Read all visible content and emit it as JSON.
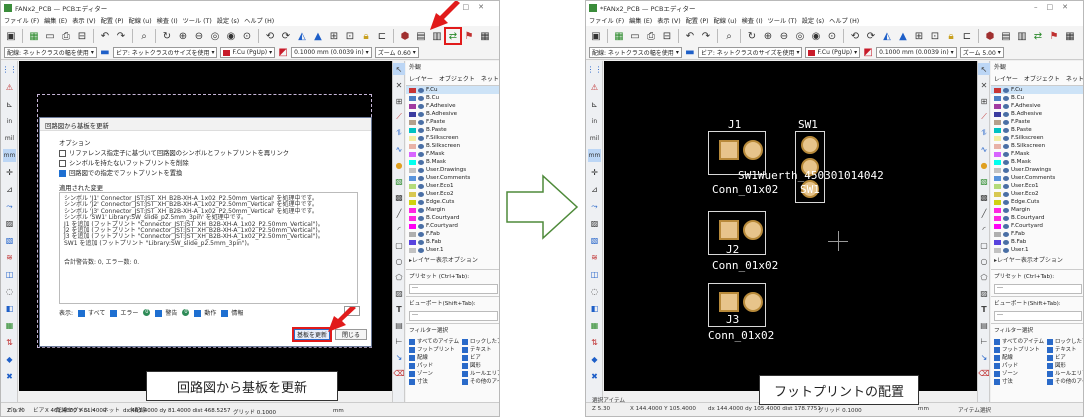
{
  "editor_left": {
    "title": "FANx2_PCB — PCBエディター",
    "menu": [
      "ファイル (F)",
      "編集 (E)",
      "表示 (V)",
      "配置 (P)",
      "配線 (u)",
      "検査 (I)",
      "ツール (T)",
      "設定 (s)",
      "ヘルプ (H)"
    ],
    "toolbar2": {
      "track_select": "配線: ネットクラスの幅を使用",
      "via_select": "ビア: ネットクラスのサイズを使用",
      "layer": "F.Cu (PgUp)",
      "grid": "0.1000 mm (0.0039 in)",
      "zoom": "ズーム 0.60"
    },
    "left_labels": {
      "in": "in",
      "mil": "mil",
      "mm": "mm"
    },
    "status": {
      "pad": "パッド",
      "via": "ビア",
      "track_segments": "配線セグメント",
      "net": "ネット",
      "unrouted": "未配線",
      "z": "Z 0.70",
      "coords": "X 461.4000  Y 81.4000",
      "delta": "dx 461.4000  dy 81.4000  dist 468.5257",
      "grid": "グリッド 0.1000",
      "unit": "mm"
    }
  },
  "dialog": {
    "title": "回路図から基板を更新",
    "options_heading": "オプション",
    "options": [
      {
        "label": "リファレンス指定子に基づいて回路図のシンボルとフットプリントを再リンク",
        "checked": false
      },
      {
        "label": "シンボルを持たないフットプリントを削除",
        "checked": false
      },
      {
        "label": "回路図での指定でフットプリントを置換",
        "checked": true
      }
    ],
    "changes_heading": "適用された変更",
    "changes": [
      "シンボル 'J1' Connector_JST:JST_XH_B2B-XH-A_1x02_P2.50mm_Vertical' を処理中です。",
      "シンボル 'J2' Connector_JST:JST_XH_B2B-XH-A_1x02_P2.50mm_Vertical' を処理中です。",
      "シンボル 'J3' Connector_JST:JST_XH_B2B-XH-A_1x02_P2.50mm_Vertical' を処理中です。",
      "シンボル 'SW1' Library:SW_slide_p2.5mm_3pin' を処理中です。",
      "J1 を追加 (フットプリント \"Connector_JST:JST_XH_B2B-XH-A_1x02_P2.50mm_Vertical\")。",
      "J2 を追加 (フットプリント \"Connector_JST:JST_XH_B2B-XH-A_1x02_P2.50mm_Vertical\")。",
      "J3 を追加 (フットプリント \"Connector_JST:JST_XH_B2B-XH-A_1x02_P2.50mm_Vertical\")。",
      "SW1 を追加 (フットプリント \"Library:SW_slide_p2.5mm_3pin\")。",
      "",
      "",
      "合計警告数: 0, エラー数: 0."
    ],
    "filter": {
      "show": "表示:",
      "all": "すべて",
      "errors": "エラー",
      "errors_count": "0",
      "warnings": "警告",
      "warnings_count": "0",
      "actions": "動作",
      "info": "情報"
    },
    "update_button": "基板を更新",
    "close_button": "閉じる"
  },
  "editor_right": {
    "title": "*FANx2_PCB — PCBエディター",
    "menu": [
      "ファイル (F)",
      "編集 (E)",
      "表示 (V)",
      "配置 (P)",
      "配線 (u)",
      "検査 (I)",
      "ツール (T)",
      "設定 (s)",
      "ヘルプ (H)"
    ],
    "toolbar2": {
      "track_select": "配線: ネットクラスの幅を使用",
      "via_select": "ビア: ネットクラスのサイズを使用",
      "layer": "F.Cu (PgUp)",
      "grid": "0.1000 mm (0.0039 in)",
      "zoom": "ズーム 5.00"
    },
    "appearance": {
      "heading": "外観",
      "tabs": [
        "レイヤー",
        "オブジェクト",
        "ネット"
      ],
      "layers": [
        {
          "name": "F.Cu",
          "color": "#c83434"
        },
        {
          "name": "B.Cu",
          "color": "#4d7fc4"
        },
        {
          "name": "F.Adhesive",
          "color": "#a13ba1"
        },
        {
          "name": "B.Adhesive",
          "color": "#3c3ca0"
        },
        {
          "name": "F.Paste",
          "color": "#b4a08c"
        },
        {
          "name": "B.Paste",
          "color": "#00c2c2"
        },
        {
          "name": "F.Silkscreen",
          "color": "#f2eda1"
        },
        {
          "name": "B.Silkscreen",
          "color": "#e8b2a7"
        },
        {
          "name": "F.Mask",
          "color": "#d864ff"
        },
        {
          "name": "B.Mask",
          "color": "#02ffee"
        },
        {
          "name": "User.Drawings",
          "color": "#c2c2c2"
        },
        {
          "name": "User.Comments",
          "color": "#5994dc"
        },
        {
          "name": "User.Eco1",
          "color": "#b4db79"
        },
        {
          "name": "User.Eco2",
          "color": "#d8c852"
        },
        {
          "name": "Edge.Cuts",
          "color": "#d0d210"
        },
        {
          "name": "Margin",
          "color": "#ff26e2"
        },
        {
          "name": "B.Courtyard",
          "color": "#ff26e2"
        },
        {
          "name": "F.Courtyard",
          "color": "#ff00f5"
        },
        {
          "name": "F.Fab",
          "color": "#afafaf"
        },
        {
          "name": "B.Fab",
          "color": "#5843dd"
        },
        {
          "name": "User.1",
          "color": "#c2c2c2"
        }
      ],
      "layer_options": "▸レイヤー表示オプション",
      "presets_label": "プリセット (Ctrl+Tab):",
      "presets_value": "---",
      "viewports_label": "ビューポート(Shift+Tab):",
      "viewports_value": "---"
    },
    "selection_filter": {
      "heading": "フィルター選択",
      "items": [
        "すべてのアイテム",
        "ロックしたアイテム",
        "フットプリント",
        "テキスト",
        "配線",
        "ビア",
        "パッド",
        "図形",
        "ゾーン",
        "ルールエリア",
        "寸法",
        "その他のアイテム"
      ]
    },
    "status": {
      "selected": "選択アイテム",
      "z": "Z 5.30",
      "coords": "X 144.4000  Y 105.4000",
      "delta": "dx 144.4000  dy 105.4000  dist 178.7751",
      "grid": "グリッド 0.1000",
      "unit": "mm",
      "tool": "アイテム選択"
    },
    "pcb_labels": {
      "j1": "J1",
      "sw1": "SW1",
      "j2": "J2",
      "j3": "J3",
      "sw_value": "SW1Wuerth_450301014042",
      "sw_ref": "SW1",
      "conn_a": "Conn_01x02",
      "conn_b": "Conn_01x02",
      "conn_c": "Conn_01x02"
    }
  },
  "captions": {
    "left": "回路図から基板を更新",
    "right": "フットプリントの配置"
  },
  "colors": {
    "pcb_background": "#000000",
    "accent": "#1e6fd1",
    "highlight": "#e11b1b",
    "arrow_outline": "#4e8a3a"
  }
}
